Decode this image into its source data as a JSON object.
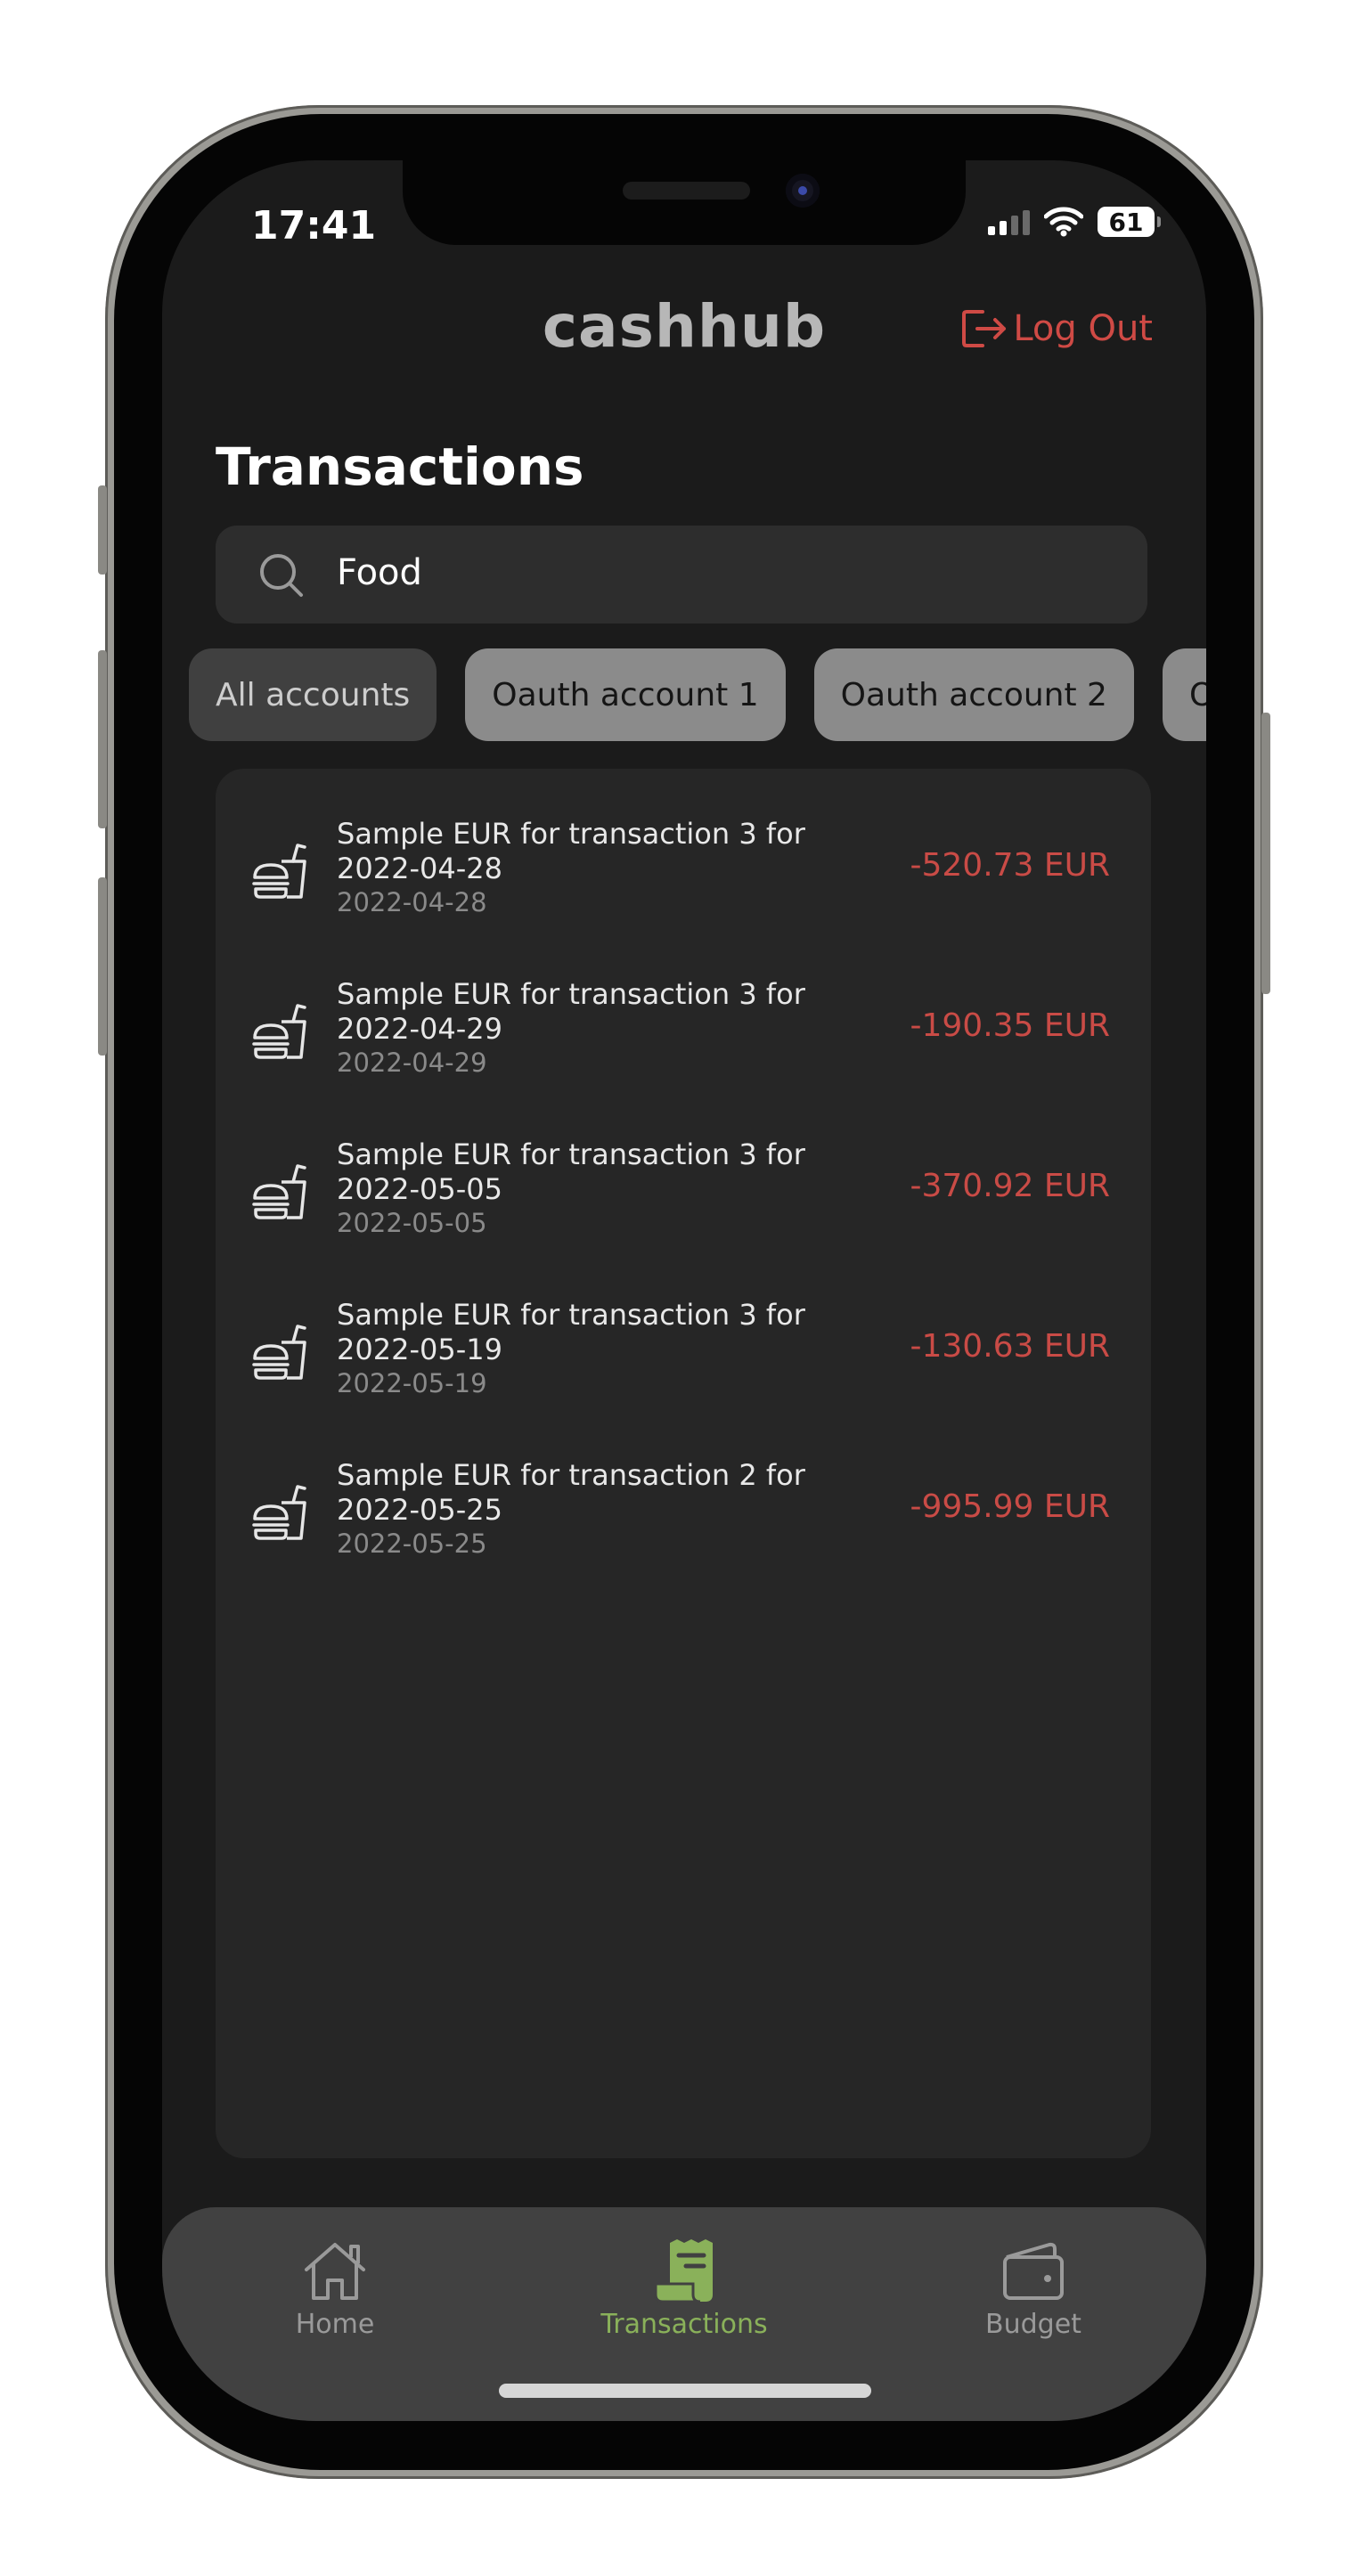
{
  "status_bar": {
    "time": "17:41",
    "battery": "61"
  },
  "header": {
    "logo": "cashhub",
    "logout_label": "Log Out"
  },
  "page": {
    "title": "Transactions"
  },
  "search": {
    "value": "Food"
  },
  "account_filters": [
    {
      "label": "All accounts",
      "selected": true
    },
    {
      "label": "Oauth account 1",
      "selected": false
    },
    {
      "label": "Oauth account 2",
      "selected": false
    },
    {
      "label": "Oaut",
      "selected": false
    }
  ],
  "transactions": [
    {
      "description": "Sample EUR for transaction 3 for 2022-04-28",
      "date": "2022-04-28",
      "amount": "-520.73 EUR",
      "icon": "fast-food-icon"
    },
    {
      "description": "Sample EUR for transaction 3 for 2022-04-29",
      "date": "2022-04-29",
      "amount": "-190.35 EUR",
      "icon": "fast-food-icon"
    },
    {
      "description": "Sample EUR for transaction 3 for 2022-05-05",
      "date": "2022-05-05",
      "amount": "-370.92 EUR",
      "icon": "fast-food-icon"
    },
    {
      "description": "Sample EUR for transaction 3 for 2022-05-19",
      "date": "2022-05-19",
      "amount": "-130.63 EUR",
      "icon": "fast-food-icon"
    },
    {
      "description": "Sample EUR for transaction 2 for 2022-05-25",
      "date": "2022-05-25",
      "amount": "-995.99 EUR",
      "icon": "fast-food-icon"
    }
  ],
  "tab_bar": [
    {
      "label": "Home",
      "icon": "home-icon",
      "active": false
    },
    {
      "label": "Transactions",
      "icon": "receipt-icon",
      "active": true
    },
    {
      "label": "Budget",
      "icon": "wallet-icon",
      "active": false
    }
  ],
  "colors": {
    "accent": "#8ab15a",
    "negative": "#c94b46",
    "logout": "#cf4a45",
    "background": "#1b1b1b",
    "card": "#262626"
  }
}
